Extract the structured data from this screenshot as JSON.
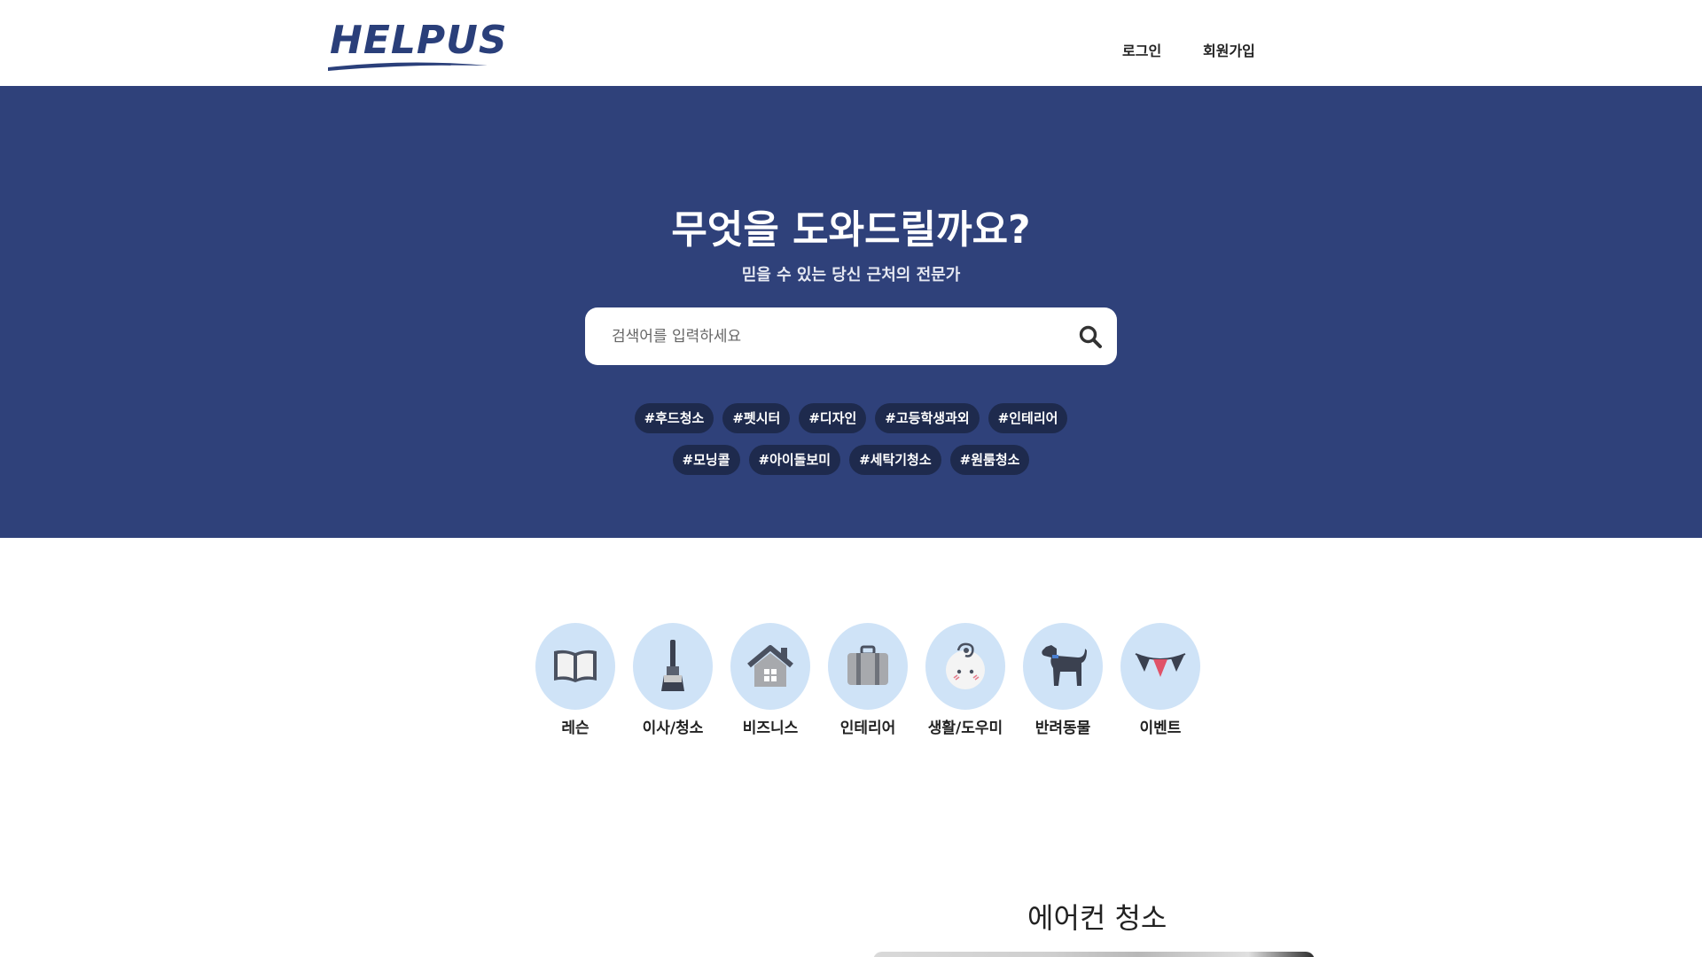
{
  "header": {
    "logo_text": "HELPUS",
    "nav": {
      "login": "로그인",
      "signup": "회원가입"
    }
  },
  "hero": {
    "title": "무엇을 도와드릴까요?",
    "subtitle": "믿을 수 있는 당신 근처의 전문가",
    "search": {
      "placeholder": "검색어를 입력하세요",
      "value": ""
    },
    "tags_row1": [
      "#후드청소",
      "#펫시터",
      "#디자인",
      "#고등학생과외",
      "#인테리어"
    ],
    "tags_row2": [
      "#모닝콜",
      "#아이돌보미",
      "#세탁기청소",
      "#원룸청소"
    ]
  },
  "categories": [
    {
      "label": "레슨",
      "icon": "book-icon"
    },
    {
      "label": "이사/청소",
      "icon": "brush-icon"
    },
    {
      "label": "비즈니스",
      "icon": "house-icon"
    },
    {
      "label": "인테리어",
      "icon": "suitcase-icon"
    },
    {
      "label": "생활/도우미",
      "icon": "baby-icon"
    },
    {
      "label": "반려동물",
      "icon": "dog-icon"
    },
    {
      "label": "이벤트",
      "icon": "bunting-icon"
    }
  ],
  "section": {
    "title": "에어컨 청소"
  },
  "colors": {
    "hero_bg": "#2f417a",
    "tag_bg": "#1e2a4d",
    "category_bg": "#cfe3f7",
    "logo": "#2a3f7a"
  }
}
